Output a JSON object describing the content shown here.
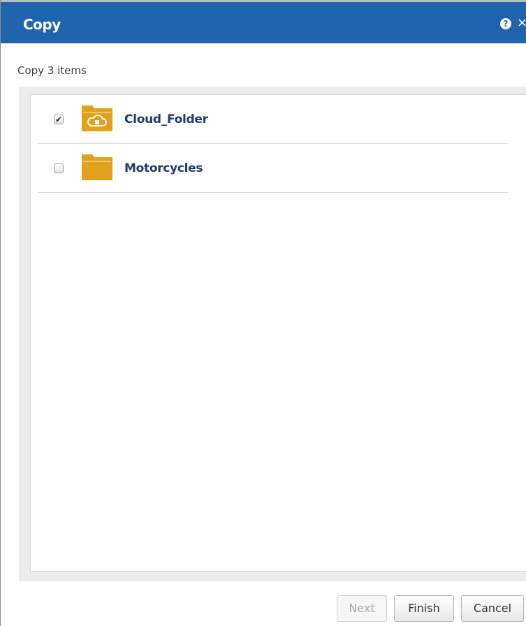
{
  "dialog": {
    "title": "Copy",
    "help_icon": "help-icon",
    "help_glyph": "?",
    "close_icon": "close-icon",
    "close_glyph": "×",
    "subtitle": "Copy 3 items"
  },
  "folders": [
    {
      "name": "Cloud_Folder",
      "checked": true,
      "icon": "cloud-folder-icon"
    },
    {
      "name": "Motorcycles",
      "checked": false,
      "icon": "folder-icon"
    }
  ],
  "buttons": {
    "next_label": "Next",
    "next_enabled": false,
    "finish_label": "Finish",
    "cancel_label": "Cancel"
  },
  "colors": {
    "titlebar": "#1f64ad",
    "folder": "#e0a21c",
    "folder_name": "#1e3a73"
  }
}
